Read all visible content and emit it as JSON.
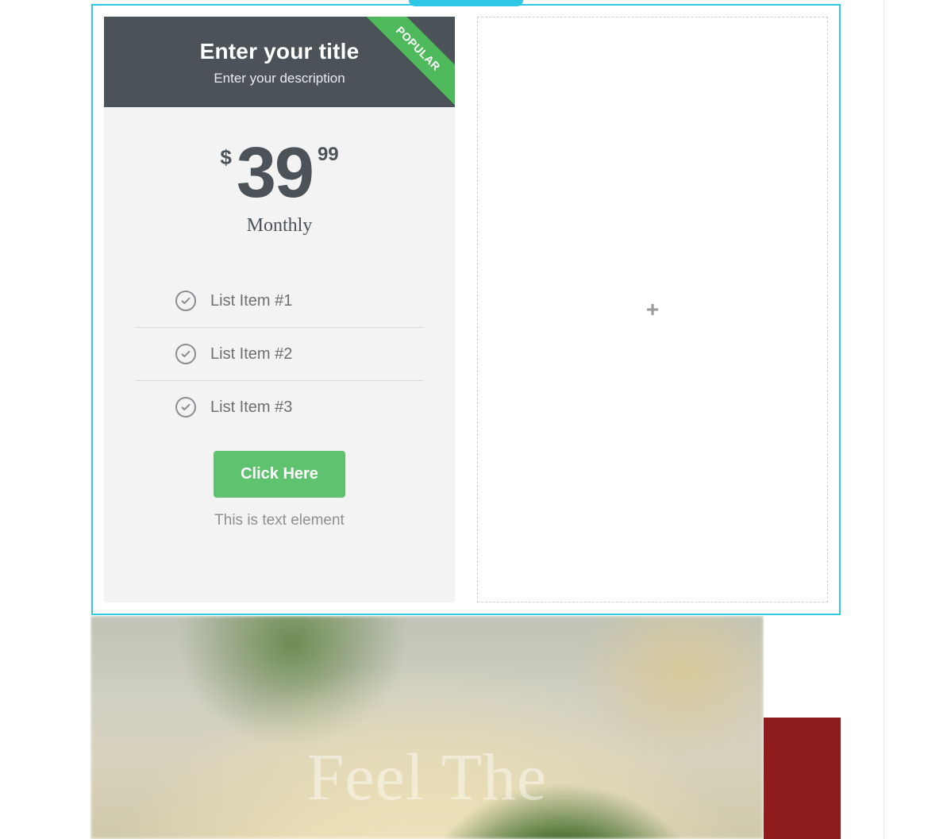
{
  "pricing": {
    "ribbon": "POPULAR",
    "title": "Enter your title",
    "description": "Enter your description",
    "currency": "$",
    "amount": "39",
    "cents": "99",
    "period": "Monthly",
    "items": [
      {
        "label": "List Item #1"
      },
      {
        "label": "List Item #2"
      },
      {
        "label": "List Item #3"
      }
    ],
    "cta_label": "Click Here",
    "below_text": "This is text element"
  },
  "hero": {
    "headline": "Feel The"
  }
}
